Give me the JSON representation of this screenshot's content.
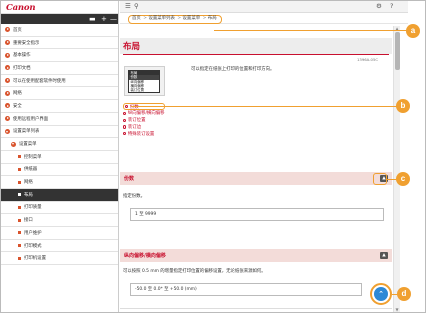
{
  "brand": {
    "logo": "Canon"
  },
  "sidebar_toolbar": {
    "collapse_all": "▬",
    "expand_all": "+",
    "minimize": "—"
  },
  "topbar": {
    "menu_icon": "☰",
    "search_icon": "⚲",
    "settings_icon": "⚙",
    "help_icon": "?"
  },
  "breadcrumb": [
    "首页",
    "设置菜单列表",
    "设置菜单",
    "布局"
  ],
  "sidebar": {
    "items": [
      {
        "label": "首页",
        "level": 0,
        "open": false
      },
      {
        "label": "重要安全指示",
        "level": 0,
        "open": false
      },
      {
        "label": "基本操作",
        "level": 0,
        "open": false
      },
      {
        "label": "打印文档",
        "level": 0,
        "open": false
      },
      {
        "label": "可以在使用配套软件时使用",
        "level": 0,
        "open": false
      },
      {
        "label": "网络",
        "level": 0,
        "open": false
      },
      {
        "label": "安全",
        "level": 0,
        "open": false
      },
      {
        "label": "使用远程用户界面",
        "level": 0,
        "open": false
      },
      {
        "label": "设置菜单列表",
        "level": 0,
        "open": true
      },
      {
        "label": "设置菜单",
        "level": 1,
        "open": true
      },
      {
        "label": "控制菜单",
        "level": 2,
        "active": false
      },
      {
        "label": "供纸器",
        "level": 2,
        "active": false
      },
      {
        "label": "网络",
        "level": 2,
        "active": false
      },
      {
        "label": "布局",
        "level": 2,
        "active": true
      },
      {
        "label": "打印质量",
        "level": 2,
        "active": false
      },
      {
        "label": "接口",
        "level": 2,
        "active": false
      },
      {
        "label": "用户维护",
        "level": 2,
        "active": false
      },
      {
        "label": "打印模式",
        "level": 2,
        "active": false
      },
      {
        "label": "打印机设置",
        "level": 2,
        "active": false
      }
    ]
  },
  "page": {
    "title": "布局",
    "doc_id": "1396A-05C",
    "description": "可以指定在纸张上打印的位置和打印方向。",
    "lcd_menu": {
      "header": "布局",
      "items": [
        "份数",
        "纵向偏移",
        "横向偏移",
        "装订位置"
      ]
    },
    "toc": [
      "份数",
      "纵向偏移/横向偏移",
      "装订位置",
      "装订边",
      "特殊装订设置"
    ]
  },
  "sections": [
    {
      "title": "份数",
      "collapse_icon": "▲",
      "text": "指定份数。",
      "value": "1 至 9999"
    },
    {
      "title": "纵向偏移/横向偏移",
      "collapse_icon": "▲",
      "text": "可以按照 0.5 mm 的增量指定打印位置的偏移设置，无论纸张来源如何。",
      "value": "-50.0 至 0.0* 至 +50.0 (mm)"
    }
  ],
  "to_top_icon": "⌃",
  "callouts": [
    "a",
    "b",
    "c",
    "d"
  ],
  "colors": {
    "brand_red": "#c8102e",
    "callout_orange": "#f0a030",
    "sidebar_bullet": "#d9532c",
    "section_band": "#f3dcd9",
    "to_top_blue": "#2d89d6"
  }
}
